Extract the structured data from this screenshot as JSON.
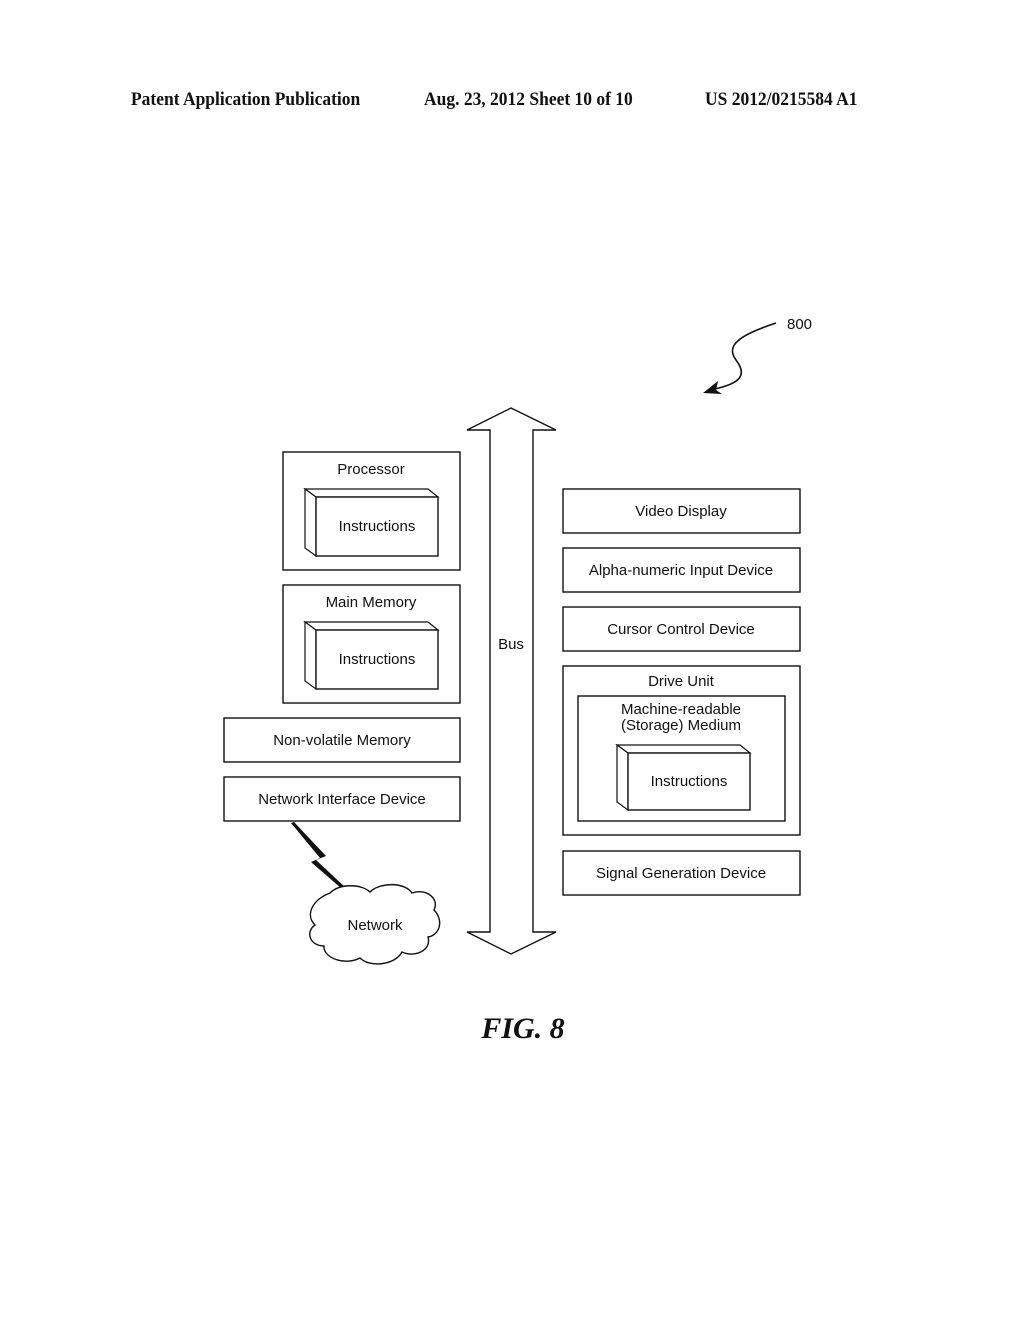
{
  "header": {
    "publication": "Patent Application Publication",
    "date_sheet": "Aug. 23, 2012  Sheet 10 of 10",
    "number": "US 2012/0215584 A1"
  },
  "figure": {
    "reference_number": "800",
    "caption": "FIG. 8",
    "bus_label": "Bus",
    "left_components": {
      "processor": {
        "label": "Processor",
        "inner": "Instructions"
      },
      "main_memory": {
        "label": "Main Memory",
        "inner": "Instructions"
      },
      "non_volatile_memory": {
        "label": "Non-volatile Memory"
      },
      "network_interface_device": {
        "label": "Network Interface Device"
      },
      "network": {
        "label": "Network"
      }
    },
    "right_components": {
      "video_display": {
        "label": "Video Display"
      },
      "alpha_numeric_input": {
        "label": "Alpha-numeric Input Device"
      },
      "cursor_control": {
        "label": "Cursor Control Device"
      },
      "drive_unit": {
        "label": "Drive Unit",
        "medium_line1": "Machine-readable",
        "medium_line2": "(Storage) Medium",
        "inner": "Instructions"
      },
      "signal_generation": {
        "label": "Signal Generation Device"
      }
    }
  }
}
